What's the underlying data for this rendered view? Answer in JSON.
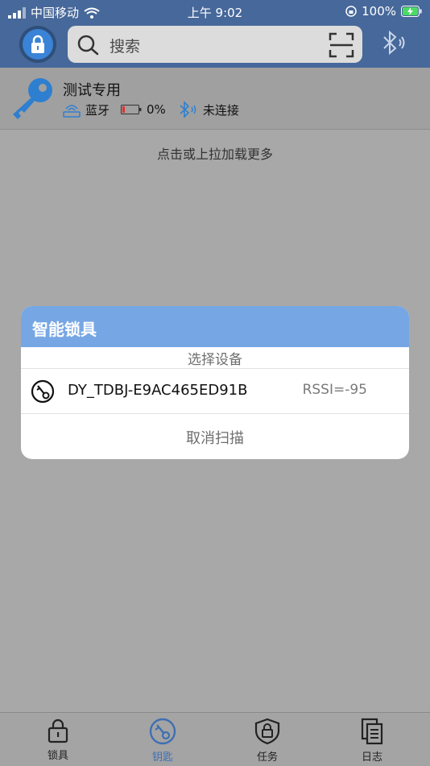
{
  "status_bar": {
    "carrier": "中国移动",
    "time": "上午 9:02",
    "battery": "100%"
  },
  "header": {
    "search_placeholder": "搜索"
  },
  "device": {
    "name": "测试专用",
    "connection_type": "蓝牙",
    "battery": "0%",
    "bluetooth_status": "未连接"
  },
  "list": {
    "load_more": "点击或上拉加载更多"
  },
  "dialog": {
    "title": "智能锁具",
    "subtitle": "选择设备",
    "devices": [
      {
        "name": "DY_TDBJ-E9AC465ED91B",
        "rssi": "RSSI=-95"
      }
    ],
    "cancel_label": "取消扫描"
  },
  "tabs": [
    {
      "label": "锁具",
      "icon": "lock-icon",
      "active": false
    },
    {
      "label": "钥匙",
      "icon": "key-circle-icon",
      "active": true
    },
    {
      "label": "任务",
      "icon": "shield-lock-icon",
      "active": false
    },
    {
      "label": "日志",
      "icon": "document-icon",
      "active": false
    }
  ],
  "colors": {
    "header": "#47689a",
    "dialog_title": "#76a7e4",
    "active_tab": "#3f6fb3",
    "key_blue": "#2f7fd0"
  }
}
